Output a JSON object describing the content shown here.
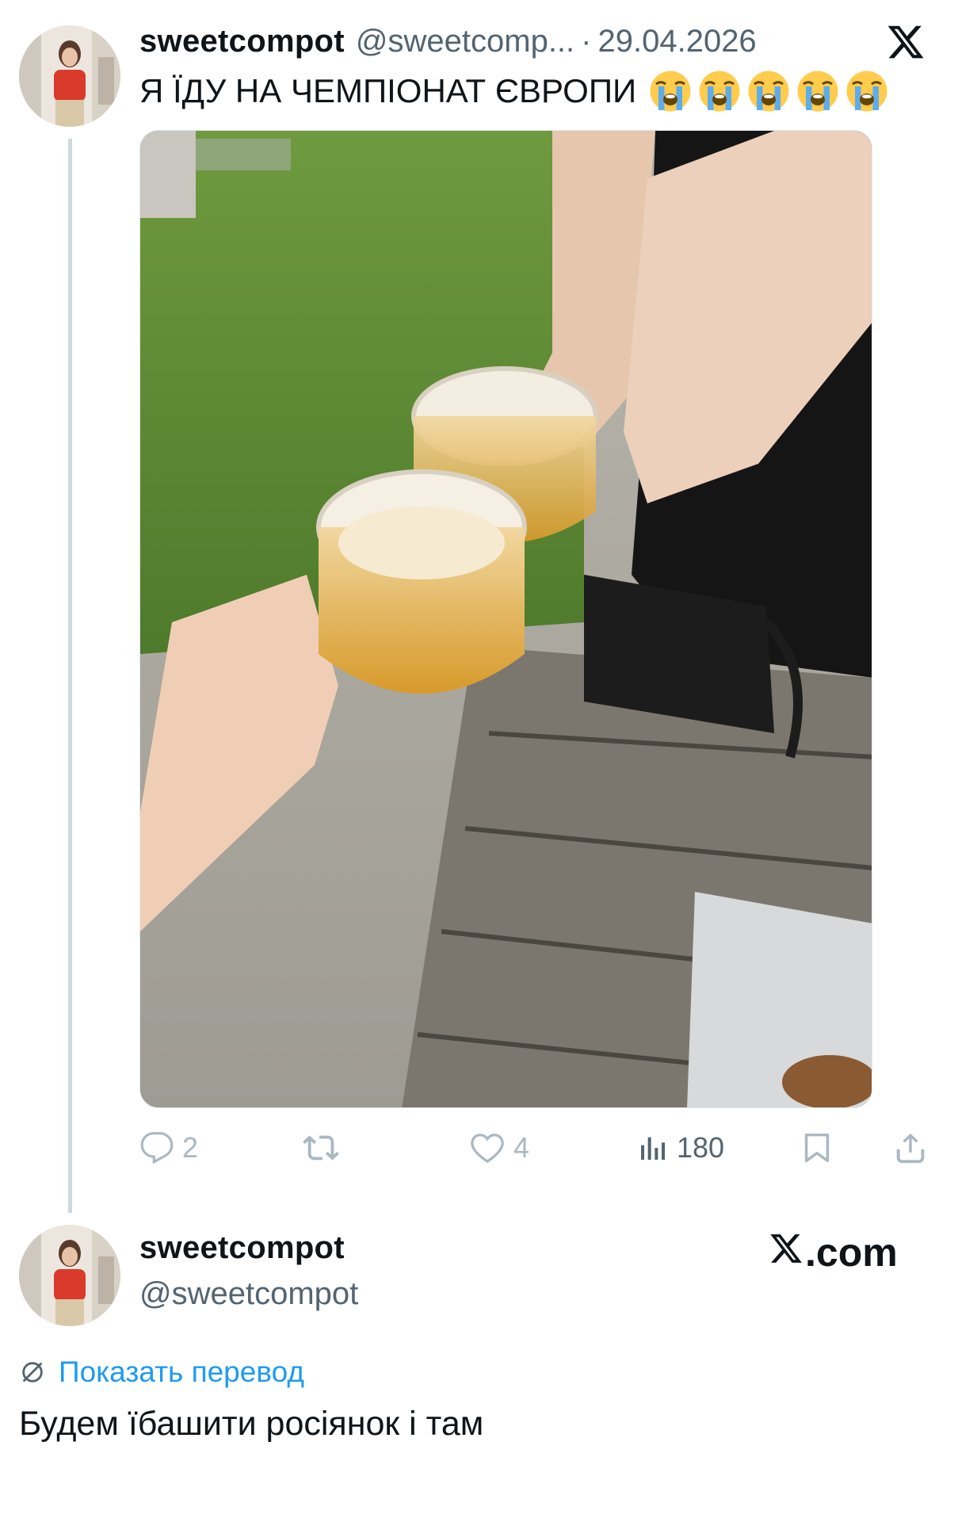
{
  "tweet": {
    "display_name": "sweetcompot",
    "handle": "@sweetcomp...",
    "separator": "·",
    "date": "29.04.2026",
    "text": "Я ЇДУ НА ЧЕМПІОНАТ ЄВРОПИ",
    "emoji_count": 5,
    "emoji_name": "loudly-crying-face",
    "actions": {
      "replies": "2",
      "reposts": "",
      "likes": "4",
      "views": "180"
    }
  },
  "profile": {
    "display_name": "sweetcompot",
    "handle": "@sweetcompot",
    "site_label": ".com"
  },
  "translation": {
    "link_label": "Показать перевод",
    "text": "Будем їбашити росіянок і там"
  },
  "colors": {
    "text_primary": "#0f1419",
    "text_secondary": "#536471",
    "link_blue": "#1d9bf0",
    "thread_line": "#cfd9de",
    "muted_icon": "#aab8c2"
  },
  "icons": {
    "close_logo": "x-logo-icon",
    "reply": "reply-icon",
    "repost": "repost-icon",
    "like": "heart-icon",
    "views": "views-bar-chart-icon",
    "bookmark": "bookmark-icon",
    "share": "share-icon",
    "translate": "globe-translate-icon"
  }
}
